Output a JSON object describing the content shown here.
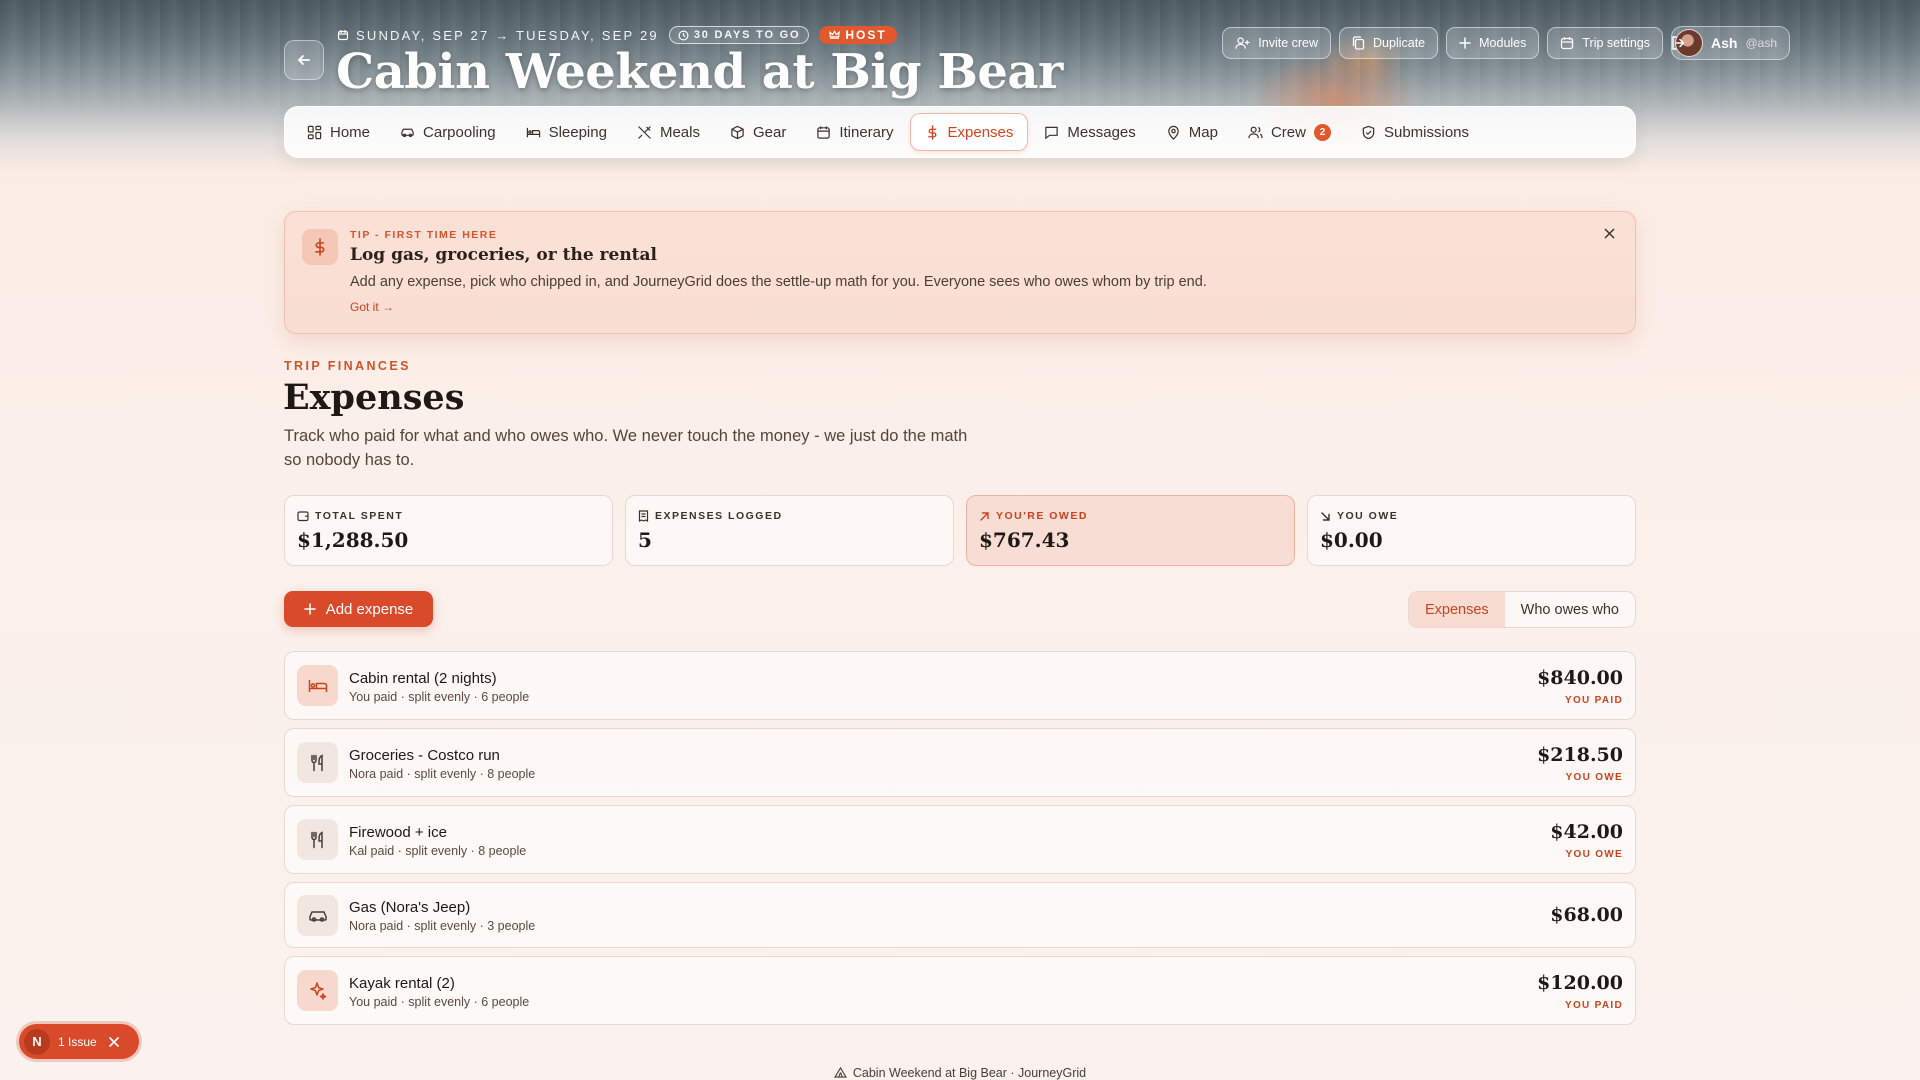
{
  "trip": {
    "dates": "SUNDAY, SEP 27 → TUESDAY, SEP 29",
    "countdown": "30 DAYS TO GO",
    "role": "HOST",
    "title": "Cabin Weekend at Big Bear"
  },
  "actions": {
    "invite": "Invite crew",
    "duplicate": "Duplicate",
    "modules": "Modules",
    "settings": "Trip settings"
  },
  "user": {
    "name": "Ash",
    "handle": "@ash"
  },
  "nav": {
    "tabs": [
      {
        "label": "Home",
        "icon": "grid-icon"
      },
      {
        "label": "Carpooling",
        "icon": "car-icon"
      },
      {
        "label": "Sleeping",
        "icon": "bed-icon"
      },
      {
        "label": "Meals",
        "icon": "utensils-icon"
      },
      {
        "label": "Gear",
        "icon": "box-icon"
      },
      {
        "label": "Itinerary",
        "icon": "calendar-icon"
      },
      {
        "label": "Expenses",
        "icon": "dollar-icon",
        "active": true
      },
      {
        "label": "Messages",
        "icon": "message-icon"
      },
      {
        "label": "Map",
        "icon": "pin-icon"
      },
      {
        "label": "Crew",
        "icon": "users-icon",
        "badge": "2"
      },
      {
        "label": "Submissions",
        "icon": "shield-icon"
      }
    ]
  },
  "tip": {
    "kicker": "TIP - FIRST TIME HERE",
    "title": "Log gas, groceries, or the rental",
    "body": "Add any expense, pick who chipped in, and JourneyGrid does the settle-up math for you. Everyone sees who owes whom by trip end.",
    "link": "Got it →"
  },
  "header": {
    "kicker": "TRIP FINANCES",
    "title": "Expenses",
    "subtitle": "Track who paid for what and who owes who. We never touch the money - we just do the math so nobody has to."
  },
  "stats": [
    {
      "label": "TOTAL SPENT",
      "value": "$1,288.50"
    },
    {
      "label": "EXPENSES LOGGED",
      "value": "5"
    },
    {
      "label": "YOU'RE OWED",
      "value": "$767.43"
    },
    {
      "label": "YOU OWE",
      "value": "$0.00"
    }
  ],
  "controls": {
    "add": "Add expense",
    "view_expenses": "Expenses",
    "view_who_owes": "Who owes who"
  },
  "expenses": [
    {
      "name": "Cabin rental (2 nights)",
      "meta": "You paid · split evenly · 6 people",
      "amount": "$840.00",
      "tag": "YOU PAID",
      "icon": "bed-icon"
    },
    {
      "name": "Groceries - Costco run",
      "meta": "Nora paid · split evenly · 8 people",
      "amount": "$218.50",
      "tag": "YOU OWE",
      "icon": "utensils-icon"
    },
    {
      "name": "Firewood + ice",
      "meta": "Kal paid · split evenly · 8 people",
      "amount": "$42.00",
      "tag": "YOU OWE",
      "icon": "utensils-icon"
    },
    {
      "name": "Gas (Nora's Jeep)",
      "meta": "Nora paid · split evenly · 3 people",
      "amount": "$68.00",
      "tag": "",
      "icon": "car-icon"
    },
    {
      "name": "Kayak rental (2)",
      "meta": "You paid · split evenly · 6 people",
      "amount": "$120.00",
      "tag": "YOU PAID",
      "icon": "sparkle-icon"
    }
  ],
  "footer": {
    "text": "Cabin Weekend at Big Bear · JourneyGrid"
  },
  "issue": {
    "badge": "N",
    "label": "1 Issue"
  },
  "colors": {
    "accent": "#d94a2b",
    "accent_soft": "#f8ddd5"
  }
}
